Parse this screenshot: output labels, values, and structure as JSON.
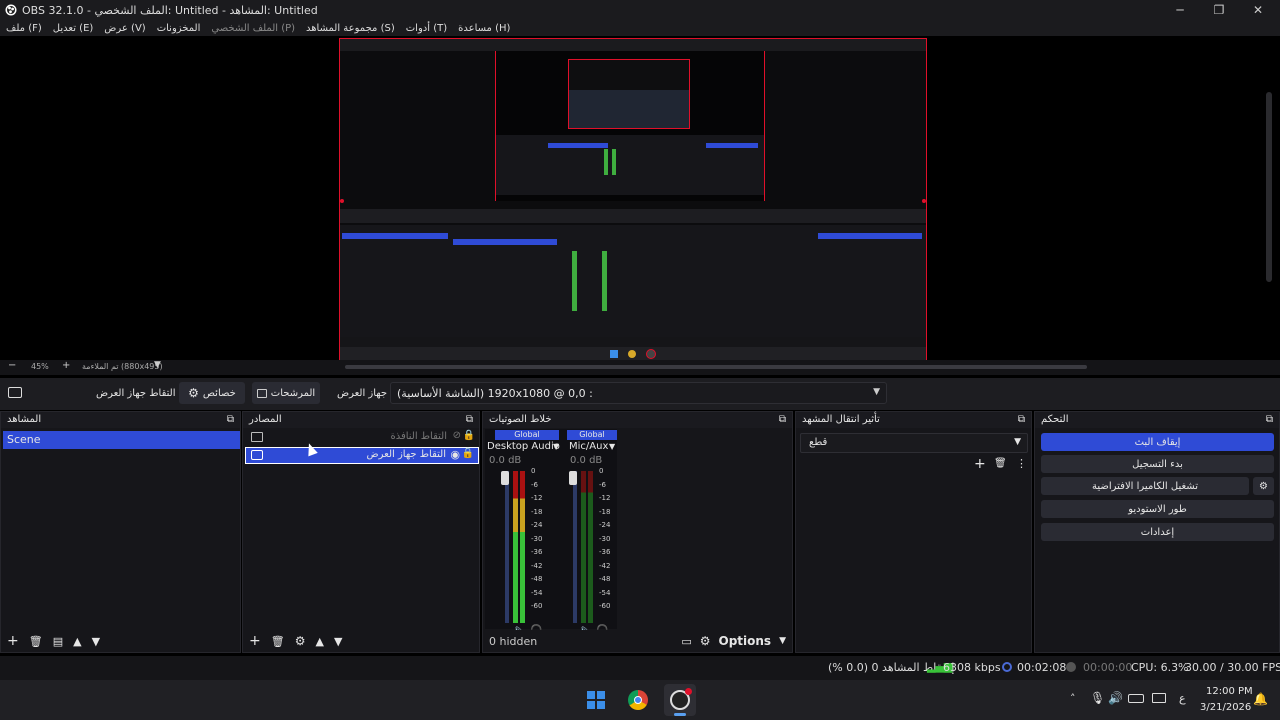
{
  "window": {
    "title": "OBS 32.1.0 - الملف الشخصي: Untitled - المشاهد: Untitled",
    "minimize": "─",
    "maximize": "❐",
    "close": "✕"
  },
  "menu": [
    "ملف (F)",
    "تعديل (E)",
    "عرض (V)",
    "المخزونات",
    "الملف الشخصي (P)",
    "مجموعة المشاهد (S)",
    "أدوات (T)",
    "مساعدة (H)"
  ],
  "zoom": {
    "percent": "45%",
    "size_label": "تم الملاءمة (880x495)"
  },
  "toolbar": {
    "source_name": "التقاط جهاز العرض",
    "properties": "خصائص",
    "filters": "المرشحات",
    "display_label": "جهاز العرض",
    "display_value": "(الشاشة الأساسية) 1920x1080 @ 0,0 :"
  },
  "scenes": {
    "title": "المشاهد",
    "items": [
      "Scene"
    ]
  },
  "sources": {
    "title": "المصادر",
    "items": [
      {
        "name": "التقاط النافذة",
        "visible": false
      },
      {
        "name": "التقاط جهاز العرض",
        "visible": true
      }
    ]
  },
  "mixer": {
    "title": "خلاط الصوتيات",
    "channels": [
      {
        "badge": "Global",
        "name": "Desktop Audio",
        "db": "0.0 dB"
      },
      {
        "badge": "Global",
        "name": "Mic/Aux",
        "db": "0.0 dB"
      }
    ],
    "scale": [
      "0",
      "-6",
      "-12",
      "-18",
      "-24",
      "-30",
      "-36",
      "-42",
      "-48",
      "-54",
      "-60"
    ],
    "hidden": "0 hidden",
    "options": "Options"
  },
  "transitions": {
    "title": "تأثير انتقال المشهد",
    "selected": "قطع"
  },
  "controls": {
    "title": "التحكم",
    "buttons": [
      "إيقاف البث",
      "بدء التسجيل",
      "تشغيل الكاميرا الافتراضية",
      "طور الاستوديو",
      "إعدادات"
    ]
  },
  "status": {
    "dropped": "إسقاط المشاهد 0 (0.0 %)",
    "bitrate": "6308 kbps",
    "stream_time": "00:02:08",
    "rec_time": "00:00:00",
    "cpu": "CPU: 6.3%",
    "fps": "30.00 / 30.00 FPS"
  },
  "taskbar": {
    "time": "12:00 PM",
    "date": "3/21/2026",
    "lang": "ع"
  },
  "colors": {
    "accent": "#2f4bd6",
    "live_border": "#e0102a"
  }
}
